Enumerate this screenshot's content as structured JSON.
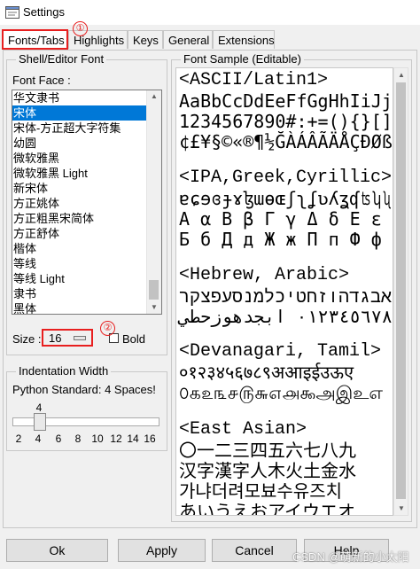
{
  "window": {
    "title": "Settings"
  },
  "tabs": [
    {
      "label": "Fonts/Tabs",
      "active": true
    },
    {
      "label": "Highlights"
    },
    {
      "label": "Keys"
    },
    {
      "label": "General"
    },
    {
      "label": "Extensions"
    }
  ],
  "annotations": {
    "step1": "①",
    "step2": "②",
    "color": "#e81f1f"
  },
  "shell_font": {
    "group_label": "Shell/Editor Font",
    "font_face_label": "Font Face :",
    "fonts": [
      "华文隶书",
      "宋体",
      "宋体-方正超大字符集",
      "幼圆",
      "微软雅黑",
      "微软雅黑 Light",
      "新宋体",
      "方正姚体",
      "方正粗黑宋简体",
      "方正舒体",
      "楷体",
      "等线",
      "等线 Light",
      "隶书",
      "黑体"
    ],
    "selected_font": "宋体",
    "size_label": "Size :",
    "size_value": "16",
    "bold_label": "Bold",
    "bold_checked": false
  },
  "indentation": {
    "group_label": "Indentation Width",
    "standard_note": "Python Standard: 4 Spaces!",
    "value": "4",
    "ticks": [
      "2",
      "4",
      "6",
      "8",
      "10",
      "12",
      "14",
      "16"
    ]
  },
  "sample": {
    "group_label": "Font Sample (Editable)",
    "lines": [
      "<ASCII/Latin1>",
      "AaBbCcDdEeFfGgHhIiJj",
      "1234567890#:+=(){}[]",
      "¢£¥§©«®¶½ĞÀÁÂÃÄÅÇÐØß",
      "",
      "<IPA,Greek,Cyrillic>",
      "ɐɕɘɞɟɤɮɯɵɶʃʅʆʋʎʓʠʦʮʯ",
      "Α α Β β Γ γ Δ δ Ε ε Ζ",
      "Б б Д д Ж ж П п Ф ф",
      "",
      "<Hebrew, Arabic>",
      "אבגדהוזחטיכלמנסעפצקר",
      "٠١٢٣٤٥٦٧٨٩ ابجدهوزحطي",
      "",
      "<Devanagari, Tamil>",
      "०१२३४५६७८९अआइईउऊए",
      "௦௧௨௩௪௫௬௭௮௯அஇஉஎ",
      "",
      "<East Asian>",
      "〇一二三四五六七八九",
      "汉字漢字人木火土金水",
      "가냐더려모뵤수유즈치",
      "あいうえおアイウエオ"
    ]
  },
  "buttons": {
    "ok": "Ok",
    "apply": "Apply",
    "cancel": "Cancel",
    "help": "Help"
  },
  "watermark": "CSDN @萌新的小太阳"
}
